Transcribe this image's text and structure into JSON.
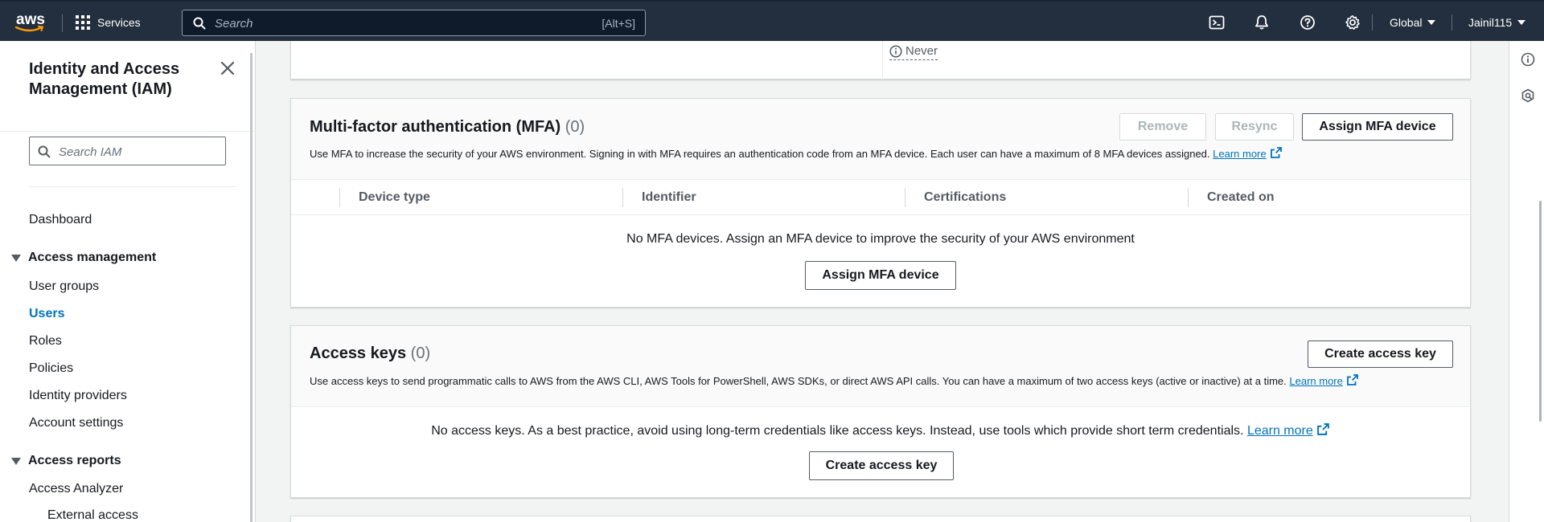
{
  "topnav": {
    "logo_text": "aws",
    "services_label": "Services",
    "search_placeholder": "Search",
    "search_shortcut": "[Alt+S]",
    "region_label": "Global",
    "user_label": "Jainil115",
    "icons": [
      "cloudshell-icon",
      "bell-icon",
      "help-icon",
      "settings-icon"
    ]
  },
  "sidebar": {
    "title": "Identity and Access Management (IAM)",
    "search_placeholder": "Search IAM",
    "dashboard": "Dashboard",
    "access_management": {
      "label": "Access management",
      "items": [
        "User groups",
        "Users",
        "Roles",
        "Policies",
        "Identity providers",
        "Account settings"
      ],
      "active": "Users"
    },
    "access_reports": {
      "label": "Access reports",
      "items": [
        "Access Analyzer"
      ],
      "sub_items": [
        "External access"
      ]
    }
  },
  "top_panel": {
    "never_label": "Never"
  },
  "mfa": {
    "title": "Multi-factor authentication (MFA)",
    "count": "(0)",
    "description": "Use MFA to increase the security of your AWS environment. Signing in with MFA requires an authentication code from an MFA device. Each user can have a maximum of 8 MFA devices assigned.",
    "learn_more": "Learn more",
    "remove_button": "Remove",
    "resync_button": "Resync",
    "assign_button": "Assign MFA device",
    "columns": [
      "Device type",
      "Identifier",
      "Certifications",
      "Created on"
    ],
    "empty_message": "No MFA devices. Assign an MFA device to improve the security of your AWS environment",
    "empty_assign_button": "Assign MFA device"
  },
  "access_keys": {
    "title": "Access keys",
    "count": "(0)",
    "description": "Use access keys to send programmatic calls to AWS from the AWS CLI, AWS Tools for PowerShell, AWS SDKs, or direct AWS API calls. You can have a maximum of two access keys (active or inactive) at a time.",
    "learn_more": "Learn more",
    "create_button": "Create access key",
    "empty_message": "No access keys. As a best practice, avoid using long-term credentials like access keys. Instead, use tools which provide short term credentials.",
    "empty_learn_more": "Learn more",
    "empty_create_button": "Create access key"
  },
  "colors": {
    "nav_bg": "#232f3e",
    "link": "#0073bb",
    "page_bg": "#f2f3f3"
  }
}
